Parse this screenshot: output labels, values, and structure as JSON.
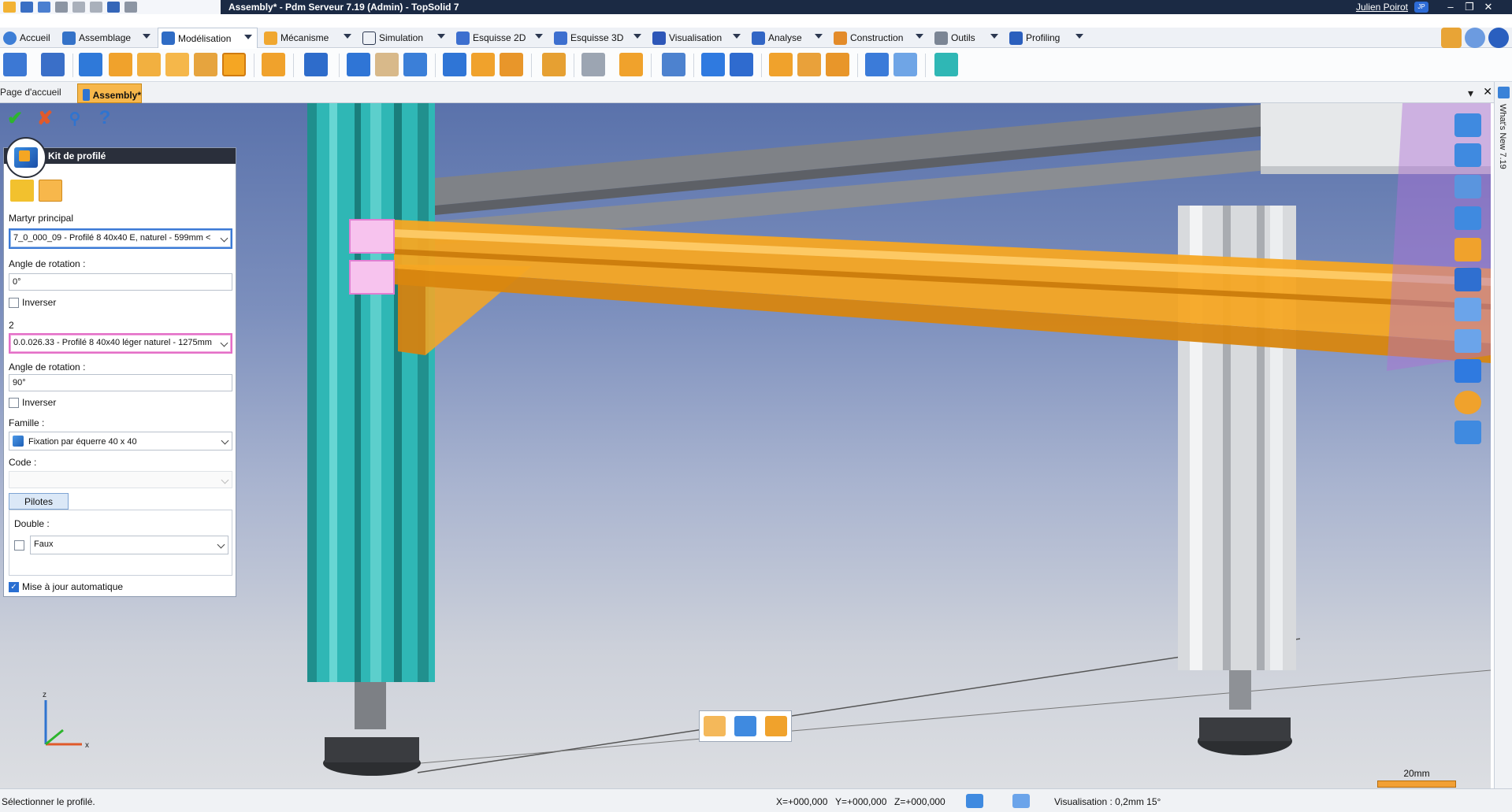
{
  "window": {
    "title": "Assembly* - Pdm Serveur 7.19 (Admin) - TopSolid 7",
    "user": "Julien Poirot",
    "user_badge": "JP"
  },
  "ribbon_tabs": [
    {
      "label": "Accueil"
    },
    {
      "label": "Assemblage"
    },
    {
      "label": "Modélisation"
    },
    {
      "label": "Mécanisme"
    },
    {
      "label": "Simulation"
    },
    {
      "label": "Esquisse 2D"
    },
    {
      "label": "Esquisse 3D"
    },
    {
      "label": "Visualisation"
    },
    {
      "label": "Analyse"
    },
    {
      "label": "Construction"
    },
    {
      "label": "Outils"
    },
    {
      "label": "Profiling"
    }
  ],
  "document_tabs": {
    "home": "Page d'accueil",
    "active": "Assembly*"
  },
  "panel": {
    "title": "Kit de profilé",
    "martyr_label": "Martyr principal",
    "martyr_value": "7_0_000_09 - Profilé 8 40x40 E, naturel - 599mm <",
    "rotation1_label": "Angle de rotation :",
    "rotation1_value": "0°",
    "invert1_label": "Inverser",
    "second_label": "2",
    "second_value": "0.0.026.33 - Profilé 8 40x40 léger naturel - 1275mm",
    "rotation2_label": "Angle de rotation :",
    "rotation2_value": "90°",
    "invert2_label": "Inverser",
    "family_label": "Famille :",
    "family_value": "Fixation par équerre 40 x 40",
    "code_label": "Code :",
    "code_value": "",
    "pilotes_tab": "Pilotes",
    "double_label": "Double :",
    "double_value": "Faux",
    "auto_update_label": "Mise à jour automatique",
    "auto_update_checked": true
  },
  "whats_new": "What's New 7.19",
  "axis": {
    "z": "z",
    "x": "x"
  },
  "scale_label": "20mm",
  "status": {
    "message": "Sélectionner le profilé.",
    "x": "X=+000,000",
    "y": "Y=+000,000",
    "z": "Z=+000,000",
    "view": "Visualisation : 0,2mm 15°"
  },
  "colors": {
    "accent_orange": "#f5a623",
    "teal_profile": "#2fb7b5",
    "titlebar": "#1b2a44"
  }
}
